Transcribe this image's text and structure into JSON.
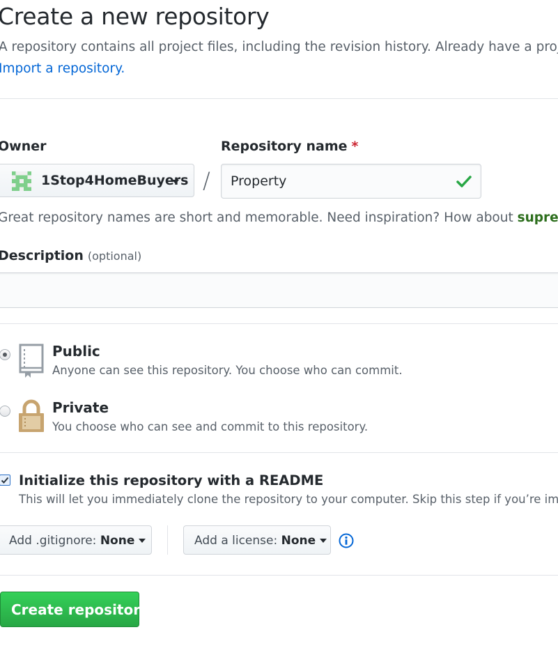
{
  "page": {
    "title": "Create a new repository",
    "subtitle": "A repository contains all project files, including the revision history. Already have a proje",
    "import_link": "Import a repository."
  },
  "owner": {
    "label": "Owner",
    "value": "1Stop4HomeBuyers"
  },
  "repo_name": {
    "label": "Repository name",
    "required_mark": "*",
    "value": "Property",
    "valid": true
  },
  "separator": "/",
  "name_hint": {
    "text": "Great repository names are short and memorable. Need inspiration? How about ",
    "suggestion": "supren"
  },
  "description": {
    "label": "Description",
    "optional_label": "(optional)",
    "value": ""
  },
  "visibility": {
    "selected": "public",
    "options": [
      {
        "id": "public",
        "title": "Public",
        "note": "Anyone can see this repository. You choose who can commit.",
        "icon": "repo-book-icon"
      },
      {
        "id": "private",
        "title": "Private",
        "note": "You choose who can see and commit to this repository.",
        "icon": "lock-icon"
      }
    ]
  },
  "readme": {
    "checked": true,
    "label": "Initialize this repository with a README",
    "note": "This will let you immediately clone the repository to your computer. Skip this step if you’re import"
  },
  "gitignore": {
    "label": "Add .gitignore:",
    "value": "None"
  },
  "license": {
    "label": "Add a license:",
    "value": "None"
  },
  "submit": {
    "label": "Create repository"
  },
  "colors": {
    "link": "#0366d6",
    "primary_button": "#28a745",
    "valid_check": "#28a745",
    "required": "#cb2431"
  }
}
